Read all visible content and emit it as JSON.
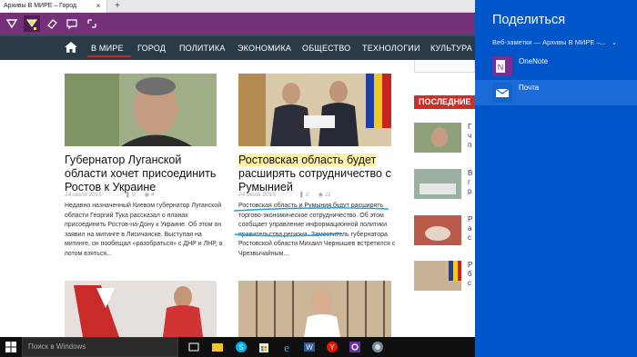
{
  "browser": {
    "tab_title": "Архивы В МИРЕ – Город",
    "tab_close": "×",
    "new_tab": "+"
  },
  "notebar": {
    "tools": [
      "pen-tool",
      "highlighter-tool",
      "eraser-tool",
      "comment-tool",
      "clip-tool"
    ]
  },
  "nav": {
    "items": [
      "В МИРЕ",
      "ГОРОД",
      "ПОЛИТИКА",
      "ЭКОНОМИКА",
      "ОБЩЕСТВО",
      "ТЕХНОЛОГИИ",
      "КУЛЬТУРА"
    ]
  },
  "articles": [
    {
      "title": "Губернатор Луганской области хочет присоединить Ростов к Украине",
      "date": "24 июля 2015",
      "views": "0",
      "comments": "4",
      "text": "Недавно назначенный Киевом губернатор Луганской области Георгий Тука рассказал о планах присоединить Ростов-на-Дону к Украине. Об этом он заявил на митинге в Лисичанске. Выступая на митинге, он пообещал «разобраться» с ДНР и ЛНР, а потом взяться..."
    },
    {
      "title": "Ростовская область будет расширять сотрудничество с Румынией",
      "title_highlight": "Ростовская область будет",
      "title_rest": " расширять сотрудничество с Румынией",
      "date": "24 июля 2015",
      "views": "0",
      "comments": "11",
      "text": "Ростовская область и Румыния будут расширять торгово-экономическое сотрудничество. Об этом сообщает управление информационной политики правительства региона. Заместитель губернатора Ростовской области Михаил Чернышев встретился с Чрезвычайным..."
    }
  ],
  "sidebar": {
    "latest_label": "ПОСЛЕДНИЕ",
    "snippets": [
      "Г\nч\nп",
      "В\nг\nр",
      "Р\nа\nс",
      "Р\nб\nс"
    ]
  },
  "taskbar": {
    "search_placeholder": "Поиск в Windows",
    "apps": [
      "task-view",
      "file-explorer",
      "skype",
      "store",
      "edge",
      "word",
      "yandex",
      "settings",
      "photos"
    ]
  },
  "share": {
    "title": "Поделиться",
    "subtitle": "Веб-заметки — Архивы В МИРЕ –...",
    "targets": [
      {
        "label": "OneNote",
        "color": "#7b2d94"
      },
      {
        "label": "Почта",
        "color": "#1266d2"
      }
    ]
  },
  "colors": {
    "notebar": "#75307a",
    "nav": "#2b3a47",
    "accent_red": "#d9231d",
    "share_charm": "#0055c8",
    "ink_blue": "#1aa3e0"
  }
}
